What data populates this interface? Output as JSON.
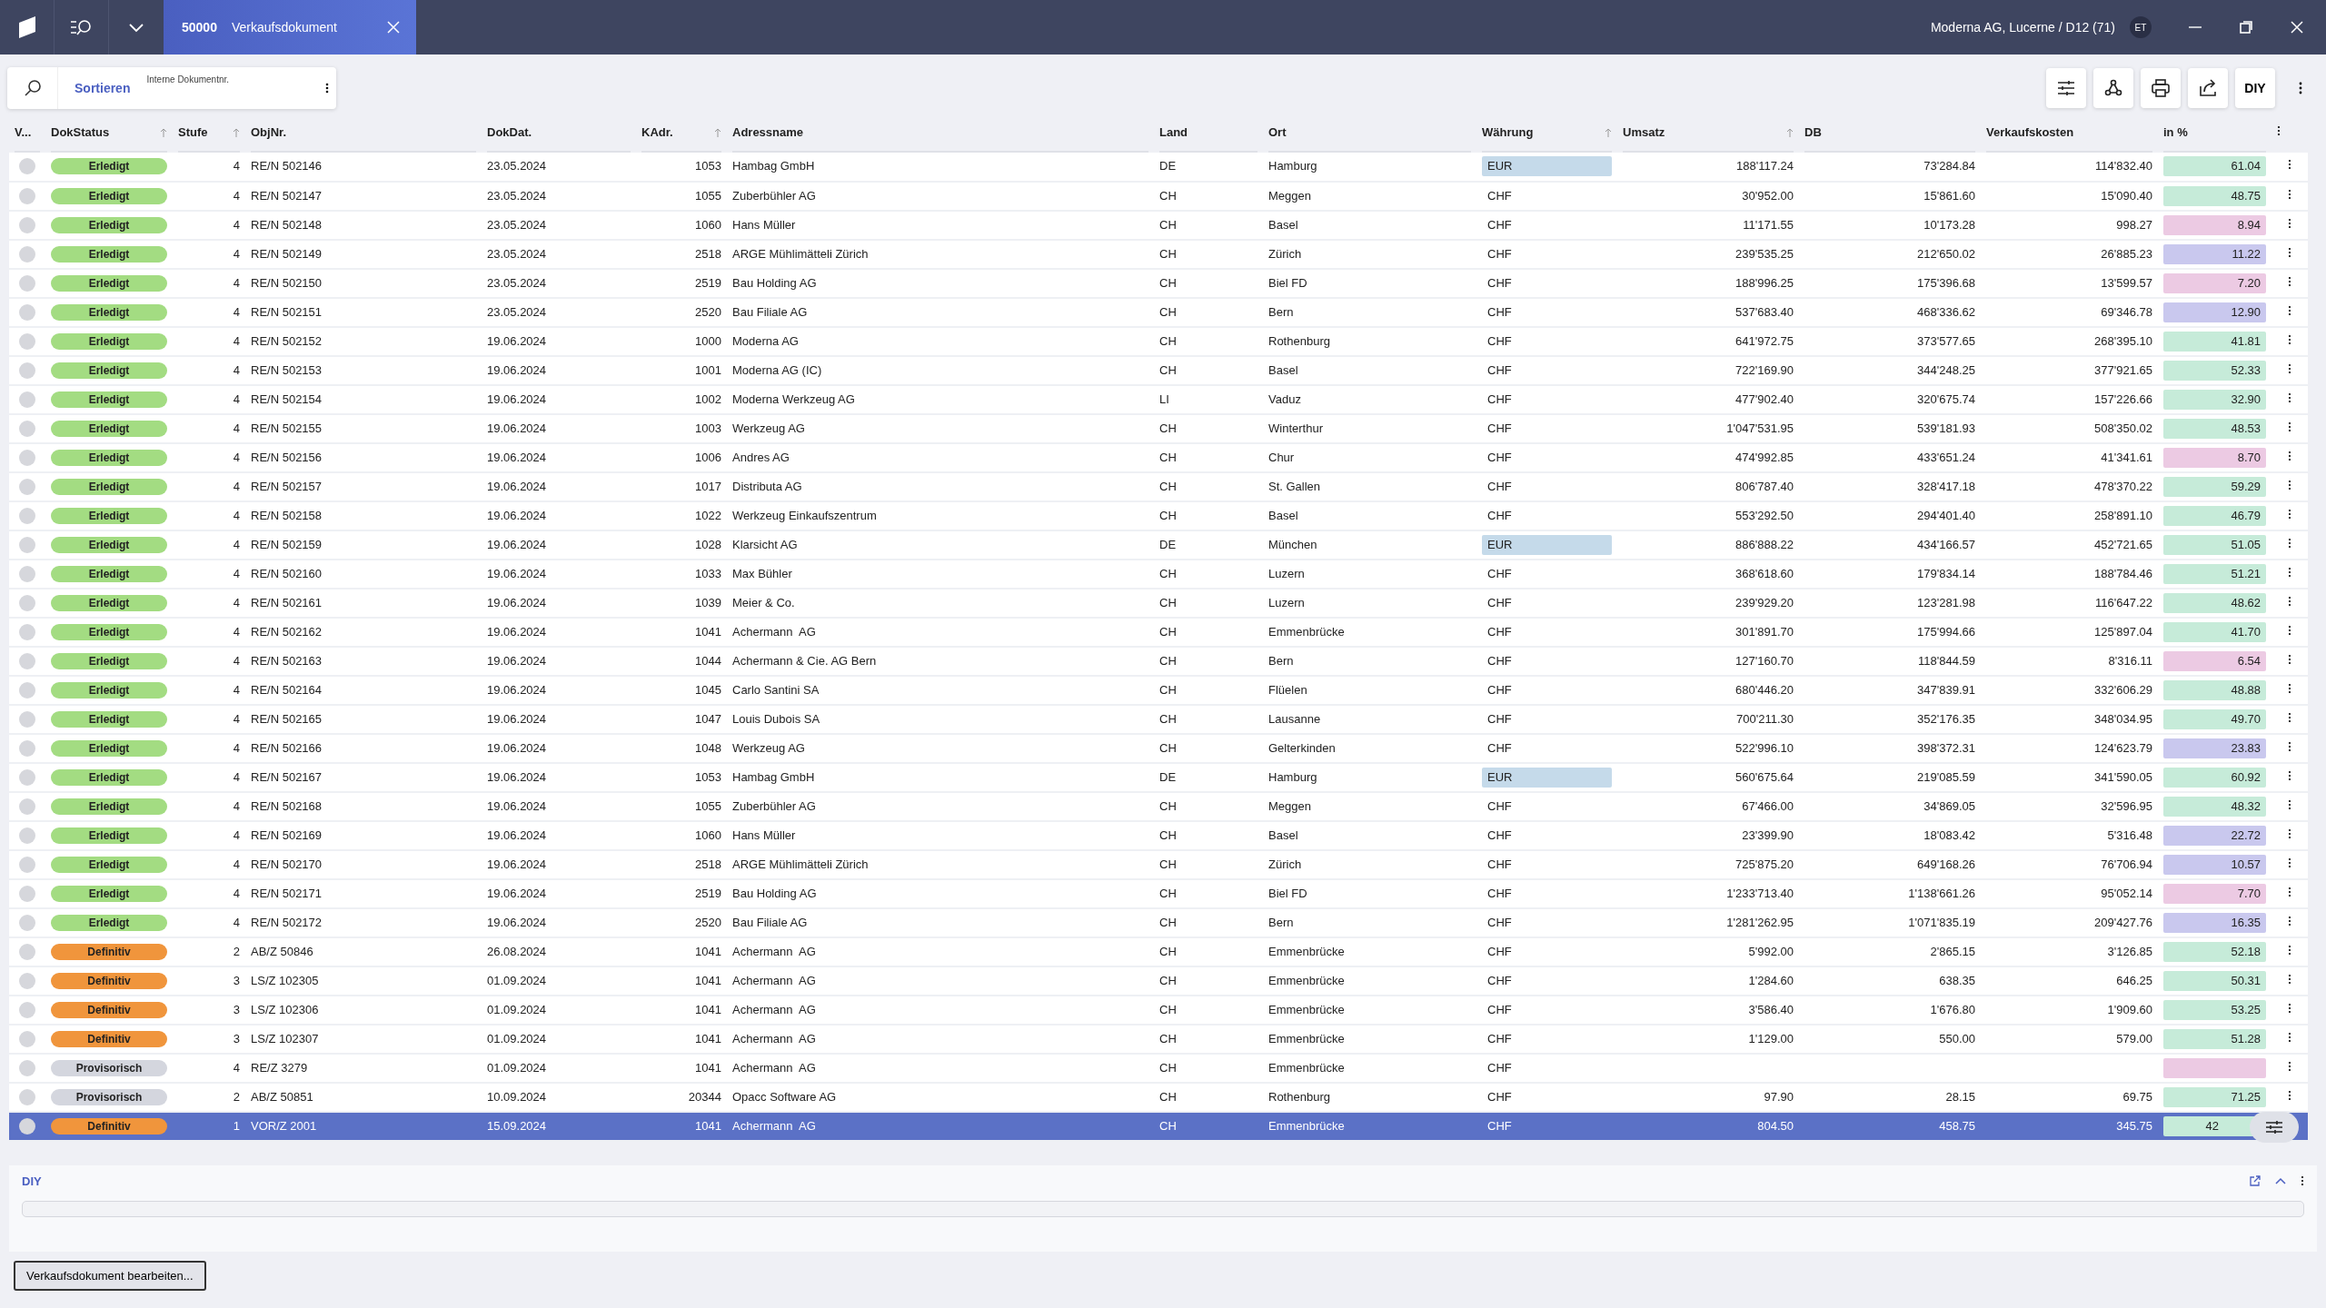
{
  "title_bar": {
    "tab": {
      "number": "50000",
      "title": "Verkaufsdokument",
      "selected": true
    },
    "context": "Moderna AG, Lucerne / D12 (71)",
    "avatar": "ET"
  },
  "search_panel": {
    "sort_label": "Sortieren",
    "field_label": "Interne Dokumentnr."
  },
  "toolbar": {
    "diy_label": "DIY"
  },
  "columns": [
    {
      "label": "V...",
      "sort_icon": false
    },
    {
      "label": "DokStatus",
      "sort_icon": true
    },
    {
      "label": "Stufe",
      "sort_icon": true
    },
    {
      "label": "ObjNr.",
      "sort_icon": false
    },
    {
      "label": "DokDat.",
      "sort_icon": false
    },
    {
      "label": "KAdr.",
      "sort_icon": true
    },
    {
      "label": "Adressname",
      "sort_icon": false
    },
    {
      "label": "Land",
      "sort_icon": false
    },
    {
      "label": "Ort",
      "sort_icon": false
    },
    {
      "label": "Währung",
      "sort_icon": true
    },
    {
      "label": "Umsatz",
      "sort_icon": true
    },
    {
      "label": "DB",
      "sort_icon": false
    },
    {
      "label": "Verkaufskosten",
      "sort_icon": false
    },
    {
      "label": "in %",
      "sort_icon": false
    }
  ],
  "rows": [
    {
      "selected": false,
      "status": {
        "label": "Erledigt",
        "color": "#a3dc82"
      },
      "stufe": "4",
      "objnr": "RE/N 502146",
      "dokdat": "23.05.2024",
      "kadr": "1053",
      "adressname": "Hambag GmbH",
      "land": "DE",
      "ort": "Hamburg",
      "currency": {
        "text": "EUR",
        "highlighted": true
      },
      "umsatz": "188'117.24",
      "db": "73'284.84",
      "verkaufskosten": "114'832.40",
      "in_pct": {
        "text": "61.04",
        "color": "#c6ebd9"
      }
    },
    {
      "selected": false,
      "status": {
        "label": "Erledigt",
        "color": "#a3dc82"
      },
      "stufe": "4",
      "objnr": "RE/N 502147",
      "dokdat": "23.05.2024",
      "kadr": "1055",
      "adressname": "Zuberbühler AG",
      "land": "CH",
      "ort": "Meggen",
      "currency": {
        "text": "CHF",
        "highlighted": false
      },
      "umsatz": "30'952.00",
      "db": "15'861.60",
      "verkaufskosten": "15'090.40",
      "in_pct": {
        "text": "48.75",
        "color": "#c6ebd9"
      }
    },
    {
      "selected": false,
      "status": {
        "label": "Erledigt",
        "color": "#a3dc82"
      },
      "stufe": "4",
      "objnr": "RE/N 502148",
      "dokdat": "23.05.2024",
      "kadr": "1060",
      "adressname": "Hans Müller",
      "land": "CH",
      "ort": "Basel",
      "currency": {
        "text": "CHF",
        "highlighted": false
      },
      "umsatz": "11'171.55",
      "db": "10'173.28",
      "verkaufskosten": "998.27",
      "in_pct": {
        "text": "8.94",
        "color": "#eccae3"
      }
    },
    {
      "selected": false,
      "status": {
        "label": "Erledigt",
        "color": "#a3dc82"
      },
      "stufe": "4",
      "objnr": "RE/N 502149",
      "dokdat": "23.05.2024",
      "kadr": "2518",
      "adressname": "ARGE Mühlimätteli Zürich",
      "land": "CH",
      "ort": "Zürich",
      "currency": {
        "text": "CHF",
        "highlighted": false
      },
      "umsatz": "239'535.25",
      "db": "212'650.02",
      "verkaufskosten": "26'885.23",
      "in_pct": {
        "text": "11.22",
        "color": "#c9c8ee"
      }
    },
    {
      "selected": false,
      "status": {
        "label": "Erledigt",
        "color": "#a3dc82"
      },
      "stufe": "4",
      "objnr": "RE/N 502150",
      "dokdat": "23.05.2024",
      "kadr": "2519",
      "adressname": "Bau Holding AG",
      "land": "CH",
      "ort": "Biel FD",
      "currency": {
        "text": "CHF",
        "highlighted": false
      },
      "umsatz": "188'996.25",
      "db": "175'396.68",
      "verkaufskosten": "13'599.57",
      "in_pct": {
        "text": "7.20",
        "color": "#eccae3"
      }
    },
    {
      "selected": false,
      "status": {
        "label": "Erledigt",
        "color": "#a3dc82"
      },
      "stufe": "4",
      "objnr": "RE/N 502151",
      "dokdat": "23.05.2024",
      "kadr": "2520",
      "adressname": "Bau Filiale AG",
      "land": "CH",
      "ort": "Bern",
      "currency": {
        "text": "CHF",
        "highlighted": false
      },
      "umsatz": "537'683.40",
      "db": "468'336.62",
      "verkaufskosten": "69'346.78",
      "in_pct": {
        "text": "12.90",
        "color": "#c9c8ee"
      }
    },
    {
      "selected": false,
      "status": {
        "label": "Erledigt",
        "color": "#a3dc82"
      },
      "stufe": "4",
      "objnr": "RE/N 502152",
      "dokdat": "19.06.2024",
      "kadr": "1000",
      "adressname": "Moderna AG",
      "land": "CH",
      "ort": "Rothenburg",
      "currency": {
        "text": "CHF",
        "highlighted": false
      },
      "umsatz": "641'972.75",
      "db": "373'577.65",
      "verkaufskosten": "268'395.10",
      "in_pct": {
        "text": "41.81",
        "color": "#c6ebd9"
      }
    },
    {
      "selected": false,
      "status": {
        "label": "Erledigt",
        "color": "#a3dc82"
      },
      "stufe": "4",
      "objnr": "RE/N 502153",
      "dokdat": "19.06.2024",
      "kadr": "1001",
      "adressname": "Moderna AG (IC)",
      "land": "CH",
      "ort": "Basel",
      "currency": {
        "text": "CHF",
        "highlighted": false
      },
      "umsatz": "722'169.90",
      "db": "344'248.25",
      "verkaufskosten": "377'921.65",
      "in_pct": {
        "text": "52.33",
        "color": "#c6ebd9"
      }
    },
    {
      "selected": false,
      "status": {
        "label": "Erledigt",
        "color": "#a3dc82"
      },
      "stufe": "4",
      "objnr": "RE/N 502154",
      "dokdat": "19.06.2024",
      "kadr": "1002",
      "adressname": "Moderna Werkzeug AG",
      "land": "LI",
      "ort": "Vaduz",
      "currency": {
        "text": "CHF",
        "highlighted": false
      },
      "umsatz": "477'902.40",
      "db": "320'675.74",
      "verkaufskosten": "157'226.66",
      "in_pct": {
        "text": "32.90",
        "color": "#c6ebd9"
      }
    },
    {
      "selected": false,
      "status": {
        "label": "Erledigt",
        "color": "#a3dc82"
      },
      "stufe": "4",
      "objnr": "RE/N 502155",
      "dokdat": "19.06.2024",
      "kadr": "1003",
      "adressname": "Werkzeug AG",
      "land": "CH",
      "ort": "Winterthur",
      "currency": {
        "text": "CHF",
        "highlighted": false
      },
      "umsatz": "1'047'531.95",
      "db": "539'181.93",
      "verkaufskosten": "508'350.02",
      "in_pct": {
        "text": "48.53",
        "color": "#c6ebd9"
      }
    },
    {
      "selected": false,
      "status": {
        "label": "Erledigt",
        "color": "#a3dc82"
      },
      "stufe": "4",
      "objnr": "RE/N 502156",
      "dokdat": "19.06.2024",
      "kadr": "1006",
      "adressname": "Andres AG",
      "land": "CH",
      "ort": "Chur",
      "currency": {
        "text": "CHF",
        "highlighted": false
      },
      "umsatz": "474'992.85",
      "db": "433'651.24",
      "verkaufskosten": "41'341.61",
      "in_pct": {
        "text": "8.70",
        "color": "#eccae3"
      }
    },
    {
      "selected": false,
      "status": {
        "label": "Erledigt",
        "color": "#a3dc82"
      },
      "stufe": "4",
      "objnr": "RE/N 502157",
      "dokdat": "19.06.2024",
      "kadr": "1017",
      "adressname": "Distributa AG",
      "land": "CH",
      "ort": "St. Gallen",
      "currency": {
        "text": "CHF",
        "highlighted": false
      },
      "umsatz": "806'787.40",
      "db": "328'417.18",
      "verkaufskosten": "478'370.22",
      "in_pct": {
        "text": "59.29",
        "color": "#c6ebd9"
      }
    },
    {
      "selected": false,
      "status": {
        "label": "Erledigt",
        "color": "#a3dc82"
      },
      "stufe": "4",
      "objnr": "RE/N 502158",
      "dokdat": "19.06.2024",
      "kadr": "1022",
      "adressname": "Werkzeug Einkaufszentrum",
      "land": "CH",
      "ort": "Basel",
      "currency": {
        "text": "CHF",
        "highlighted": false
      },
      "umsatz": "553'292.50",
      "db": "294'401.40",
      "verkaufskosten": "258'891.10",
      "in_pct": {
        "text": "46.79",
        "color": "#c6ebd9"
      }
    },
    {
      "selected": false,
      "status": {
        "label": "Erledigt",
        "color": "#a3dc82"
      },
      "stufe": "4",
      "objnr": "RE/N 502159",
      "dokdat": "19.06.2024",
      "kadr": "1028",
      "adressname": "Klarsicht AG",
      "land": "DE",
      "ort": "München",
      "currency": {
        "text": "EUR",
        "highlighted": true
      },
      "umsatz": "886'888.22",
      "db": "434'166.57",
      "verkaufskosten": "452'721.65",
      "in_pct": {
        "text": "51.05",
        "color": "#c6ebd9"
      }
    },
    {
      "selected": false,
      "status": {
        "label": "Erledigt",
        "color": "#a3dc82"
      },
      "stufe": "4",
      "objnr": "RE/N 502160",
      "dokdat": "19.06.2024",
      "kadr": "1033",
      "adressname": "Max Bühler",
      "land": "CH",
      "ort": "Luzern",
      "currency": {
        "text": "CHF",
        "highlighted": false
      },
      "umsatz": "368'618.60",
      "db": "179'834.14",
      "verkaufskosten": "188'784.46",
      "in_pct": {
        "text": "51.21",
        "color": "#c6ebd9"
      }
    },
    {
      "selected": false,
      "status": {
        "label": "Erledigt",
        "color": "#a3dc82"
      },
      "stufe": "4",
      "objnr": "RE/N 502161",
      "dokdat": "19.06.2024",
      "kadr": "1039",
      "adressname": "Meier & Co.",
      "land": "CH",
      "ort": "Luzern",
      "currency": {
        "text": "CHF",
        "highlighted": false
      },
      "umsatz": "239'929.20",
      "db": "123'281.98",
      "verkaufskosten": "116'647.22",
      "in_pct": {
        "text": "48.62",
        "color": "#c6ebd9"
      }
    },
    {
      "selected": false,
      "status": {
        "label": "Erledigt",
        "color": "#a3dc82"
      },
      "stufe": "4",
      "objnr": "RE/N 502162",
      "dokdat": "19.06.2024",
      "kadr": "1041",
      "adressname": "Achermann  AG",
      "land": "CH",
      "ort": "Emmenbrücke",
      "currency": {
        "text": "CHF",
        "highlighted": false
      },
      "umsatz": "301'891.70",
      "db": "175'994.66",
      "verkaufskosten": "125'897.04",
      "in_pct": {
        "text": "41.70",
        "color": "#c6ebd9"
      }
    },
    {
      "selected": false,
      "status": {
        "label": "Erledigt",
        "color": "#a3dc82"
      },
      "stufe": "4",
      "objnr": "RE/N 502163",
      "dokdat": "19.06.2024",
      "kadr": "1044",
      "adressname": "Achermann & Cie. AG Bern",
      "land": "CH",
      "ort": "Bern",
      "currency": {
        "text": "CHF",
        "highlighted": false
      },
      "umsatz": "127'160.70",
      "db": "118'844.59",
      "verkaufskosten": "8'316.11",
      "in_pct": {
        "text": "6.54",
        "color": "#eccae3"
      }
    },
    {
      "selected": false,
      "status": {
        "label": "Erledigt",
        "color": "#a3dc82"
      },
      "stufe": "4",
      "objnr": "RE/N 502164",
      "dokdat": "19.06.2024",
      "kadr": "1045",
      "adressname": "Carlo Santini SA",
      "land": "CH",
      "ort": "Flüelen",
      "currency": {
        "text": "CHF",
        "highlighted": false
      },
      "umsatz": "680'446.20",
      "db": "347'839.91",
      "verkaufskosten": "332'606.29",
      "in_pct": {
        "text": "48.88",
        "color": "#c6ebd9"
      }
    },
    {
      "selected": false,
      "status": {
        "label": "Erledigt",
        "color": "#a3dc82"
      },
      "stufe": "4",
      "objnr": "RE/N 502165",
      "dokdat": "19.06.2024",
      "kadr": "1047",
      "adressname": "Louis Dubois SA",
      "land": "CH",
      "ort": "Lausanne",
      "currency": {
        "text": "CHF",
        "highlighted": false
      },
      "umsatz": "700'211.30",
      "db": "352'176.35",
      "verkaufskosten": "348'034.95",
      "in_pct": {
        "text": "49.70",
        "color": "#c6ebd9"
      }
    },
    {
      "selected": false,
      "status": {
        "label": "Erledigt",
        "color": "#a3dc82"
      },
      "stufe": "4",
      "objnr": "RE/N 502166",
      "dokdat": "19.06.2024",
      "kadr": "1048",
      "adressname": "Werkzeug AG",
      "land": "CH",
      "ort": "Gelterkinden",
      "currency": {
        "text": "CHF",
        "highlighted": false
      },
      "umsatz": "522'996.10",
      "db": "398'372.31",
      "verkaufskosten": "124'623.79",
      "in_pct": {
        "text": "23.83",
        "color": "#c9c8ee"
      }
    },
    {
      "selected": false,
      "status": {
        "label": "Erledigt",
        "color": "#a3dc82"
      },
      "stufe": "4",
      "objnr": "RE/N 502167",
      "dokdat": "19.06.2024",
      "kadr": "1053",
      "adressname": "Hambag GmbH",
      "land": "DE",
      "ort": "Hamburg",
      "currency": {
        "text": "EUR",
        "highlighted": true
      },
      "umsatz": "560'675.64",
      "db": "219'085.59",
      "verkaufskosten": "341'590.05",
      "in_pct": {
        "text": "60.92",
        "color": "#c6ebd9"
      }
    },
    {
      "selected": false,
      "status": {
        "label": "Erledigt",
        "color": "#a3dc82"
      },
      "stufe": "4",
      "objnr": "RE/N 502168",
      "dokdat": "19.06.2024",
      "kadr": "1055",
      "adressname": "Zuberbühler AG",
      "land": "CH",
      "ort": "Meggen",
      "currency": {
        "text": "CHF",
        "highlighted": false
      },
      "umsatz": "67'466.00",
      "db": "34'869.05",
      "verkaufskosten": "32'596.95",
      "in_pct": {
        "text": "48.32",
        "color": "#c6ebd9"
      }
    },
    {
      "selected": false,
      "status": {
        "label": "Erledigt",
        "color": "#a3dc82"
      },
      "stufe": "4",
      "objnr": "RE/N 502169",
      "dokdat": "19.06.2024",
      "kadr": "1060",
      "adressname": "Hans Müller",
      "land": "CH",
      "ort": "Basel",
      "currency": {
        "text": "CHF",
        "highlighted": false
      },
      "umsatz": "23'399.90",
      "db": "18'083.42",
      "verkaufskosten": "5'316.48",
      "in_pct": {
        "text": "22.72",
        "color": "#c9c8ee"
      }
    },
    {
      "selected": false,
      "status": {
        "label": "Erledigt",
        "color": "#a3dc82"
      },
      "stufe": "4",
      "objnr": "RE/N 502170",
      "dokdat": "19.06.2024",
      "kadr": "2518",
      "adressname": "ARGE Mühlimätteli Zürich",
      "land": "CH",
      "ort": "Zürich",
      "currency": {
        "text": "CHF",
        "highlighted": false
      },
      "umsatz": "725'875.20",
      "db": "649'168.26",
      "verkaufskosten": "76'706.94",
      "in_pct": {
        "text": "10.57",
        "color": "#c9c8ee"
      }
    },
    {
      "selected": false,
      "status": {
        "label": "Erledigt",
        "color": "#a3dc82"
      },
      "stufe": "4",
      "objnr": "RE/N 502171",
      "dokdat": "19.06.2024",
      "kadr": "2519",
      "adressname": "Bau Holding AG",
      "land": "CH",
      "ort": "Biel FD",
      "currency": {
        "text": "CHF",
        "highlighted": false
      },
      "umsatz": "1'233'713.40",
      "db": "1'138'661.26",
      "verkaufskosten": "95'052.14",
      "in_pct": {
        "text": "7.70",
        "color": "#eccae3"
      }
    },
    {
      "selected": false,
      "status": {
        "label": "Erledigt",
        "color": "#a3dc82"
      },
      "stufe": "4",
      "objnr": "RE/N 502172",
      "dokdat": "19.06.2024",
      "kadr": "2520",
      "adressname": "Bau Filiale AG",
      "land": "CH",
      "ort": "Bern",
      "currency": {
        "text": "CHF",
        "highlighted": false
      },
      "umsatz": "1'281'262.95",
      "db": "1'071'835.19",
      "verkaufskosten": "209'427.76",
      "in_pct": {
        "text": "16.35",
        "color": "#c9c8ee"
      }
    },
    {
      "selected": false,
      "status": {
        "label": "Definitiv",
        "color": "#f0953c"
      },
      "stufe": "2",
      "objnr": "AB/Z 50846",
      "dokdat": "26.08.2024",
      "kadr": "1041",
      "adressname": "Achermann  AG",
      "land": "CH",
      "ort": "Emmenbrücke",
      "currency": {
        "text": "CHF",
        "highlighted": false
      },
      "umsatz": "5'992.00",
      "db": "2'865.15",
      "verkaufskosten": "3'126.85",
      "in_pct": {
        "text": "52.18",
        "color": "#c6ebd9"
      }
    },
    {
      "selected": false,
      "status": {
        "label": "Definitiv",
        "color": "#f0953c"
      },
      "stufe": "3",
      "objnr": "LS/Z 102305",
      "dokdat": "01.09.2024",
      "kadr": "1041",
      "adressname": "Achermann  AG",
      "land": "CH",
      "ort": "Emmenbrücke",
      "currency": {
        "text": "CHF",
        "highlighted": false
      },
      "umsatz": "1'284.60",
      "db": "638.35",
      "verkaufskosten": "646.25",
      "in_pct": {
        "text": "50.31",
        "color": "#c6ebd9"
      }
    },
    {
      "selected": false,
      "status": {
        "label": "Definitiv",
        "color": "#f0953c"
      },
      "stufe": "3",
      "objnr": "LS/Z 102306",
      "dokdat": "01.09.2024",
      "kadr": "1041",
      "adressname": "Achermann  AG",
      "land": "CH",
      "ort": "Emmenbrücke",
      "currency": {
        "text": "CHF",
        "highlighted": false
      },
      "umsatz": "3'586.40",
      "db": "1'676.80",
      "verkaufskosten": "1'909.60",
      "in_pct": {
        "text": "53.25",
        "color": "#c6ebd9"
      }
    },
    {
      "selected": false,
      "status": {
        "label": "Definitiv",
        "color": "#f0953c"
      },
      "stufe": "3",
      "objnr": "LS/Z 102307",
      "dokdat": "01.09.2024",
      "kadr": "1041",
      "adressname": "Achermann  AG",
      "land": "CH",
      "ort": "Emmenbrücke",
      "currency": {
        "text": "CHF",
        "highlighted": false
      },
      "umsatz": "1'129.00",
      "db": "550.00",
      "verkaufskosten": "579.00",
      "in_pct": {
        "text": "51.28",
        "color": "#c6ebd9"
      }
    },
    {
      "selected": false,
      "status": {
        "label": "Provisorisch",
        "color": "#d4d6de"
      },
      "stufe": "4",
      "objnr": "RE/Z 3279",
      "dokdat": "01.09.2024",
      "kadr": "1041",
      "adressname": "Achermann  AG",
      "land": "CH",
      "ort": "Emmenbrücke",
      "currency": {
        "text": "CHF",
        "highlighted": false
      },
      "in_pct": {
        "color": "#eccae3"
      }
    },
    {
      "selected": false,
      "status": {
        "label": "Provisorisch",
        "color": "#d4d6de"
      },
      "stufe": "2",
      "objnr": "AB/Z 50851",
      "dokdat": "10.09.2024",
      "kadr": "20344",
      "adressname": "Opacc Software AG",
      "land": "CH",
      "ort": "Rothenburg",
      "currency": {
        "text": "CHF",
        "highlighted": false
      },
      "umsatz": "97.90",
      "db": "28.15",
      "verkaufskosten": "69.75",
      "in_pct": {
        "text": "71.25",
        "color": "#c6ebd9"
      }
    },
    {
      "selected": true,
      "status": {
        "label": "Definitiv",
        "color": "#f0953c"
      },
      "stufe": "1",
      "objnr": "VOR/Z 2001",
      "dokdat": "15.09.2024",
      "kadr": "1041",
      "adressname": "Achermann  AG",
      "land": "CH",
      "ort": "Emmenbrücke",
      "currency": {
        "text": "CHF",
        "highlighted": false
      },
      "umsatz": "804.50",
      "db": "458.75",
      "verkaufskosten": "345.75",
      "in_pct": {
        "text": "42",
        "color": "#c6ebd9"
      }
    }
  ],
  "diy_panel": {
    "logo": "DIY"
  },
  "footer": {
    "edit_button": "Verkaufsdokument bearbeiten..."
  }
}
